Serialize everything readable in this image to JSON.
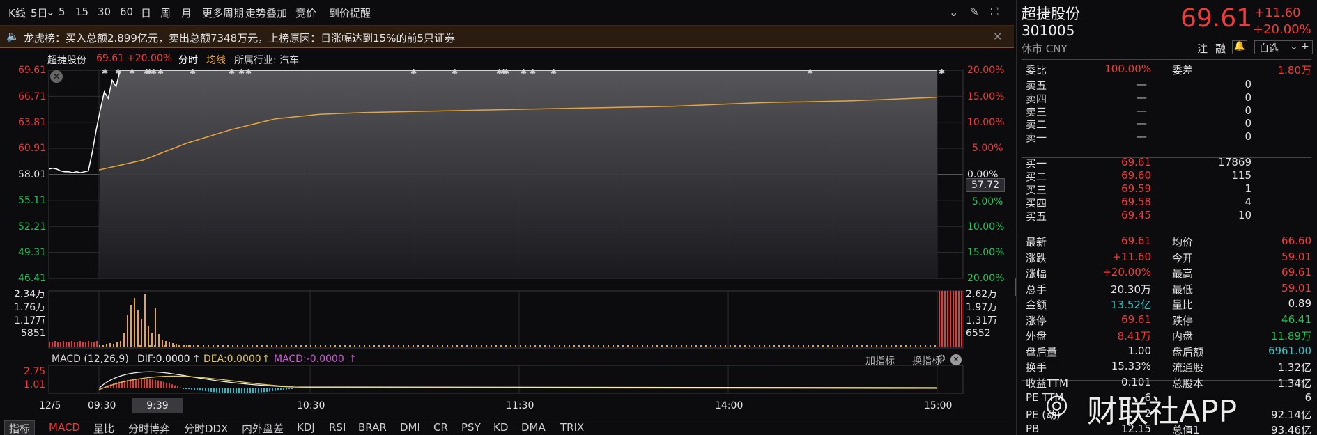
{
  "toolbar": {
    "items": [
      "K线",
      "5日",
      "5",
      "15",
      "30",
      "60",
      "日",
      "周",
      "月",
      "更多周期",
      "走势叠加",
      "竞价",
      "到价提醒"
    ]
  },
  "notice": {
    "text": "龙虎榜：买入总额2.899亿元，卖出总额7348万元，上榜原因：日涨幅达到15%的前5只证券"
  },
  "header": {
    "name": "超捷股份",
    "price": "69.61",
    "pct": "+20.00%",
    "btn_fenshi": "分时",
    "btn_junxian": "均线",
    "industry": "所属行业: 汽车"
  },
  "chart_data": {
    "type": "line",
    "title": "超捷股份",
    "price_axis": {
      "left_ticks": [
        "69.61",
        "66.71",
        "63.81",
        "60.91",
        "58.01",
        "55.11",
        "52.21",
        "49.31",
        "46.41"
      ],
      "right_ticks": [
        "20.00%",
        "15.00%",
        "10.00%",
        "5.00%",
        "0.00%",
        "5.00%",
        "10.00%",
        "15.00%",
        "20.00%"
      ],
      "ylim": [
        46.41,
        69.61
      ],
      "ref_price": 58.01,
      "cursor_value": "57.72"
    },
    "x_ticks": [
      "12/5",
      "09:30",
      "10:30",
      "11:30",
      "14:00",
      "15:00"
    ],
    "x_cursor": "9:39",
    "series": [
      {
        "name": "",
        "values": [
          58.6,
          58.7,
          58.6,
          58.4,
          58.3,
          58.3,
          58.2,
          58.3,
          58.2,
          58.3,
          58.4,
          60.5,
          63.0,
          65.2,
          67.2,
          66.5,
          68.5,
          67.8,
          69.61,
          69.61
        ]
      },
      {
        "name": "均线",
        "values": [
          58.5,
          59.6,
          61.5,
          63.0,
          64.2,
          64.7,
          64.9,
          65.0,
          65.1,
          65.2,
          65.3,
          65.4,
          65.5,
          65.6,
          65.8,
          66.0,
          66.1,
          66.2,
          66.4,
          66.6
        ]
      }
    ],
    "volume": {
      "left_ticks": [
        "2.34万",
        "1.76万",
        "1.17万",
        "5851"
      ],
      "right_ticks": [
        "2.62万",
        "1.97万",
        "1.31万",
        "6552"
      ]
    },
    "macd": {
      "label": "MACD (12,26,9)",
      "dif": "DIF:0.0000",
      "dea": "DEA:0.0000",
      "macd": "MACD:-0.0000",
      "ticks": [
        "2.75",
        "1.01"
      ],
      "actions": [
        "加指标",
        "换指标"
      ]
    }
  },
  "bottom_tabs": [
    "指标",
    "MACD",
    "量比",
    "分时博弈",
    "分时DDX",
    "内外盘差",
    "KDJ",
    "RSI",
    "BRAR",
    "DMI",
    "CR",
    "PSY",
    "KD",
    "DMA",
    "TRIX"
  ],
  "quote": {
    "name": "超捷股份",
    "code": "301005",
    "status": "休市 CNY",
    "price": "69.61",
    "chg": "+11.60",
    "pct": "+20.00%",
    "zhu": "注",
    "rong": "融",
    "zixuan": "自选",
    "weibi": {
      "label": "委比",
      "value": "100.00%"
    },
    "weicha": {
      "label": "委差",
      "value": "1.80万"
    },
    "asks": [
      {
        "label": "卖五",
        "price": "—",
        "vol": "0"
      },
      {
        "label": "卖四",
        "price": "—",
        "vol": "0"
      },
      {
        "label": "卖三",
        "price": "—",
        "vol": "0"
      },
      {
        "label": "卖二",
        "price": "—",
        "vol": "0"
      },
      {
        "label": "卖一",
        "price": "—",
        "vol": "0"
      }
    ],
    "bids": [
      {
        "label": "买一",
        "price": "69.61",
        "vol": "17869"
      },
      {
        "label": "买二",
        "price": "69.60",
        "vol": "115"
      },
      {
        "label": "买三",
        "price": "69.59",
        "vol": "1"
      },
      {
        "label": "买四",
        "price": "69.58",
        "vol": "4"
      },
      {
        "label": "买五",
        "price": "69.45",
        "vol": "10"
      }
    ],
    "stats": [
      {
        "l": "最新",
        "v": "69.61",
        "vc": "red",
        "l2": "均价",
        "v2": "66.60",
        "v2c": "red"
      },
      {
        "l": "涨跌",
        "v": "+11.60",
        "vc": "red",
        "l2": "今开",
        "v2": "59.01",
        "v2c": "red"
      },
      {
        "l": "涨幅",
        "v": "+20.00%",
        "vc": "red",
        "l2": "最高",
        "v2": "69.61",
        "v2c": "red"
      },
      {
        "l": "总手",
        "v": "20.30万",
        "vc": "white",
        "l2": "最低",
        "v2": "59.01",
        "v2c": "red"
      },
      {
        "l": "金额",
        "v": "13.52亿",
        "vc": "cyan",
        "l2": "量比",
        "v2": "0.89",
        "v2c": "white"
      },
      {
        "l": "涨停",
        "v": "69.61",
        "vc": "red",
        "l2": "跌停",
        "v2": "46.41",
        "v2c": "green"
      },
      {
        "l": "外盘",
        "v": "8.41万",
        "vc": "red",
        "l2": "内盘",
        "v2": "11.89万",
        "v2c": "green"
      },
      {
        "l": "盘后量",
        "v": "1.00",
        "vc": "white",
        "l2": "盘后额",
        "v2": "6961.00",
        "v2c": "cyan"
      },
      {
        "l": "换手",
        "v": "15.33%",
        "vc": "white",
        "l2": "流通股",
        "v2": "1.32亿",
        "v2c": "white"
      },
      {
        "l": "收益TTM",
        "v": "0.101",
        "vc": "white",
        "l2": "总股本",
        "v2": "1.34亿",
        "v2c": "white"
      },
      {
        "l": "PE TTM",
        "v": "6",
        "vc": "white",
        "l2": "",
        "v2": "6",
        "v2c": "white"
      },
      {
        "l": "PE (动)",
        "v": "2",
        "vc": "white",
        "l2": "",
        "v2": "92.14亿",
        "v2c": "white"
      },
      {
        "l": "PB",
        "v": "12.15",
        "vc": "white",
        "l2": "总值1",
        "v2": "93.46亿",
        "v2c": "white"
      }
    ],
    "watermark": "财联社APP"
  }
}
